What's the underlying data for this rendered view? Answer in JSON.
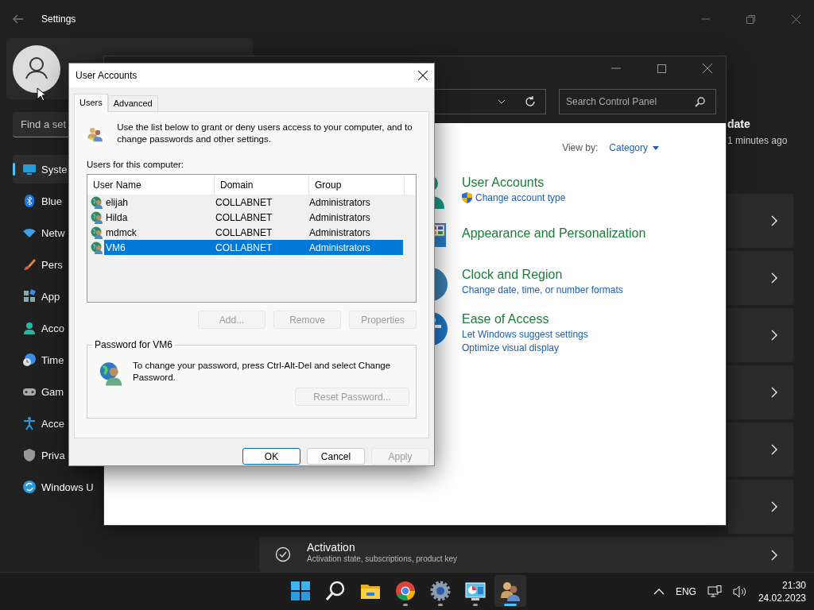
{
  "settings": {
    "title": "Settings",
    "search": {
      "placeholder": "Find a set"
    },
    "nav": [
      {
        "label": "Syste",
        "selected": true
      },
      {
        "label": "Blue",
        "selected": false
      },
      {
        "label": "Netw",
        "selected": false
      },
      {
        "label": "Pers",
        "selected": false
      },
      {
        "label": "App",
        "selected": false
      },
      {
        "label": "Acco",
        "selected": false
      },
      {
        "label": "Time",
        "selected": false
      },
      {
        "label": "Gam",
        "selected": false
      },
      {
        "label": "Acce",
        "selected": false
      },
      {
        "label": "Priva",
        "selected": false
      },
      {
        "label": "Windows U",
        "selected": false
      }
    ],
    "update": {
      "title": "date",
      "subtitle": "1 minutes ago"
    },
    "cards": [
      {
        "kind": "blank"
      },
      {
        "kind": "blank"
      },
      {
        "kind": "blank"
      },
      {
        "kind": "blank"
      },
      {
        "kind": "blank"
      },
      {
        "kind": "blank"
      },
      {
        "kind": "activation",
        "title": "Activation",
        "subtitle": "Activation state, subscriptions, product key"
      }
    ]
  },
  "control_panel": {
    "search": {
      "placeholder": "Search Control Panel"
    },
    "view_by": {
      "label": "View by:",
      "value": "Category"
    },
    "categories": [
      {
        "kind": "users",
        "title": "User Accounts",
        "links": [
          {
            "text": "Change account type",
            "shield": true
          }
        ]
      },
      {
        "kind": "appearance",
        "title": "Appearance and Personalization"
      },
      {
        "kind": "clock",
        "title": "Clock and Region",
        "links": [
          {
            "text": "Change date, time, or number formats",
            "shield": false
          }
        ]
      },
      {
        "kind": "access",
        "title": "Ease of Access",
        "links": [
          {
            "text": "Let Windows suggest settings",
            "shield": false
          },
          {
            "text": "Optimize visual display",
            "shield": false
          }
        ]
      }
    ]
  },
  "dialog": {
    "title": "User Accounts",
    "tabs": [
      {
        "label": "Users",
        "selected": true
      },
      {
        "label": "Advanced",
        "selected": false
      }
    ],
    "intro": "Use the list below to grant or deny users access to your computer, and to change passwords and other settings.",
    "list_label": "Users for this computer:",
    "columns": [
      "User Name",
      "Domain",
      "Group"
    ],
    "rows": [
      {
        "name": "elijah",
        "domain": "COLLABNET",
        "group": "Administrators",
        "selected": false
      },
      {
        "name": "Hilda",
        "domain": "COLLABNET",
        "group": "Administrators",
        "selected": false
      },
      {
        "name": "mdmck",
        "domain": "COLLABNET",
        "group": "Administrators",
        "selected": false
      },
      {
        "name": "VM6",
        "domain": "COLLABNET",
        "group": "Administrators",
        "selected": true
      }
    ],
    "list_buttons": [
      {
        "label": "Add...",
        "disabled": true
      },
      {
        "label": "Remove",
        "disabled": true
      },
      {
        "label": "Properties",
        "disabled": true
      }
    ],
    "password": {
      "legend": "Password for VM6",
      "text": "To change your password, press Ctrl-Alt-Del and select Change Password.",
      "button": {
        "label": "Reset Password...",
        "disabled": true
      }
    },
    "buttons": [
      {
        "label": "OK",
        "default": true,
        "disabled": false
      },
      {
        "label": "Cancel",
        "default": false,
        "disabled": false
      },
      {
        "label": "Apply",
        "default": false,
        "disabled": true
      }
    ]
  },
  "taskbar": {
    "apps": [
      {
        "kind": "start",
        "running": false,
        "active": false
      },
      {
        "kind": "search",
        "running": false,
        "active": false
      },
      {
        "kind": "explorer",
        "running": false,
        "active": false
      },
      {
        "kind": "chrome",
        "running": true,
        "active": false
      },
      {
        "kind": "settings",
        "running": true,
        "active": false
      },
      {
        "kind": "controlpanel",
        "running": true,
        "active": false
      },
      {
        "kind": "users",
        "running": true,
        "active": true
      }
    ],
    "language": "ENG",
    "time": "21:30",
    "date": "24.02.2023"
  }
}
